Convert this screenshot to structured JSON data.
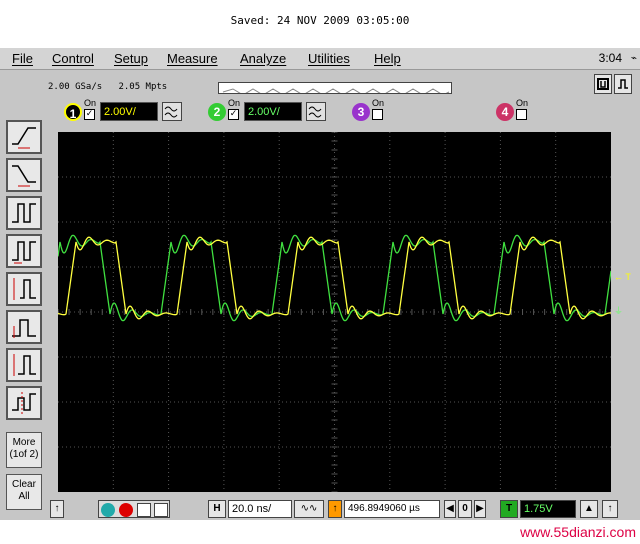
{
  "saved": "Saved:  24 NOV 2009  03:05:00",
  "menu": [
    "File",
    "Control",
    "Setup",
    "Measure",
    "Analyze",
    "Utilities",
    "Help"
  ],
  "clock": "3:04",
  "acquisition": {
    "rate": "2.00 GSa/s",
    "memory": "2.05 Mpts"
  },
  "channels": [
    {
      "num": "1",
      "on_label": "On",
      "checked": true,
      "scale": "2.00V/",
      "color": "#ffff00"
    },
    {
      "num": "2",
      "on_label": "On",
      "checked": true,
      "scale": "2.00V/",
      "color": "#33cc33"
    },
    {
      "num": "3",
      "on_label": "On",
      "checked": false,
      "color": "#9933cc"
    },
    {
      "num": "4",
      "on_label": "On",
      "checked": false,
      "color": "#cc3366"
    }
  ],
  "side": {
    "more": "More",
    "more_sub": "(1of 2)",
    "clear": "Clear",
    "clear_sub": "All"
  },
  "markers": {
    "trigger": "← T"
  },
  "timebase": {
    "h_label": "H",
    "scale": "20.0 ns/",
    "position": "496.8949060 µs",
    "delay_center": "0",
    "trig_label": "T",
    "trig_level": "1.75V"
  },
  "watermark": "www.55dianzi.com",
  "colors": {
    "trace1": "#ffff40",
    "trace2": "#40e040",
    "grid": "#555555",
    "screen": "#000000"
  }
}
